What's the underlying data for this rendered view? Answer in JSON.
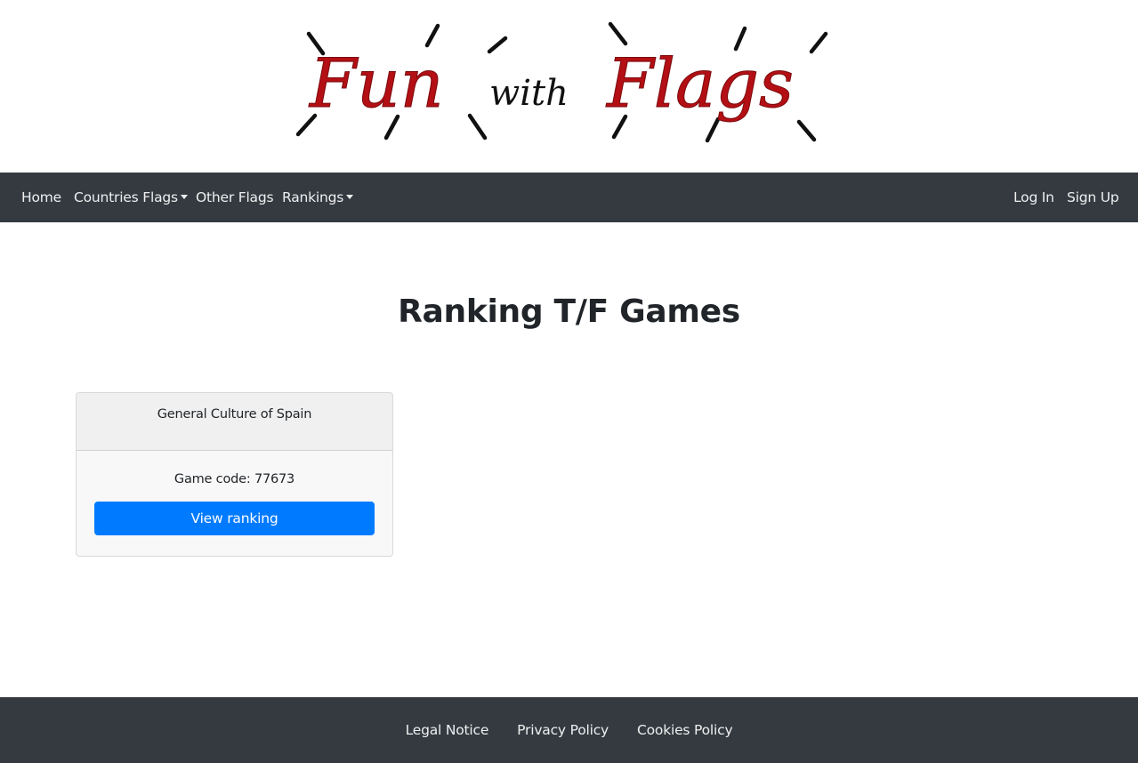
{
  "logo": {
    "word1": "Fun",
    "word2": "with",
    "word3": "Flags",
    "alt": "Fun with Flags",
    "accent_color": "#b30f14",
    "ink_color": "#111111"
  },
  "navbar": {
    "left": [
      {
        "label": "Home",
        "dropdown": false
      },
      {
        "label": "Countries Flags",
        "dropdown": true
      },
      {
        "label": "Other Flags",
        "dropdown": false
      },
      {
        "label": "Rankings",
        "dropdown": true
      }
    ],
    "right": [
      {
        "label": "Log In"
      },
      {
        "label": "Sign Up"
      }
    ]
  },
  "main": {
    "title": "Ranking T/F Games",
    "cards": [
      {
        "header": "General Culture of Spain",
        "game_code": "Game code: 77673",
        "button_label": "View ranking"
      }
    ]
  },
  "footer": {
    "links": [
      {
        "label": "Legal Notice"
      },
      {
        "label": "Privacy Policy"
      },
      {
        "label": "Cookies Policy"
      }
    ]
  },
  "colors": {
    "navbar_bg": "#343a40",
    "primary": "#007bff"
  }
}
